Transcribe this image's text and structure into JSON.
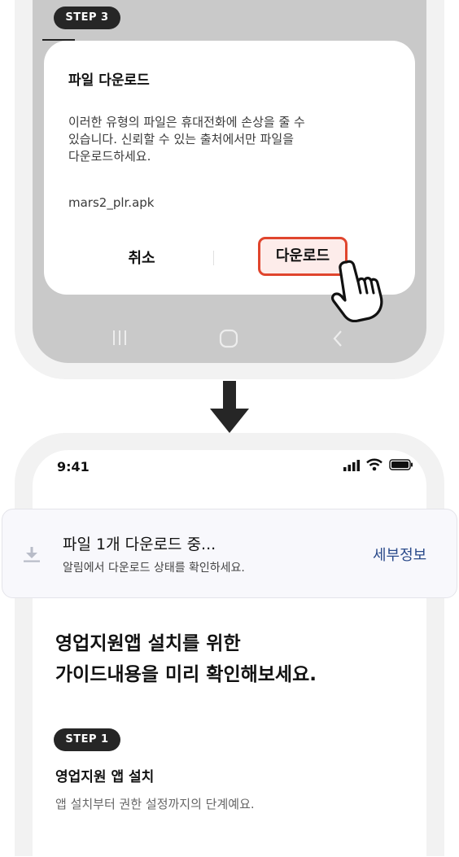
{
  "top_phone": {
    "step_badge": "STEP 3",
    "dialog": {
      "title": "파일 다운로드",
      "message_lines": [
        "이러한 유형의 파일은 휴대전화에 손상을 줄 수",
        "있습니다. 신뢰할 수 있는 출처에서만 파일을",
        "다운로드하세요."
      ],
      "filename": "mars2_plr.apk",
      "cancel_label": "취소",
      "download_label": "다운로드"
    },
    "nav_icons": [
      "recent-apps-icon",
      "home-icon",
      "back-icon"
    ]
  },
  "bottom_phone": {
    "status_bar": {
      "time": "9:41",
      "icons": [
        "signal-icon",
        "wifi-icon",
        "battery-icon"
      ]
    },
    "notification": {
      "title": "파일 1개 다운로드 중...",
      "subtitle": "알림에서 다운로드 상태를 확인하세요.",
      "detail_label": "세부정보",
      "icon": "download-icon"
    },
    "headline_lines": [
      "영업지원앱 설치를 위한",
      "가이드내용을 미리 확인해보세요."
    ],
    "step1": {
      "badge": "STEP 1",
      "title": "영업지원 앱 설치",
      "description": "앱 설치부터 권한 설정까지의 단계예요."
    }
  },
  "colors": {
    "highlight_border": "#e0452d",
    "highlight_fill": "#fdecea",
    "badge_bg": "#262626",
    "detail_link": "#2a4a8a"
  }
}
